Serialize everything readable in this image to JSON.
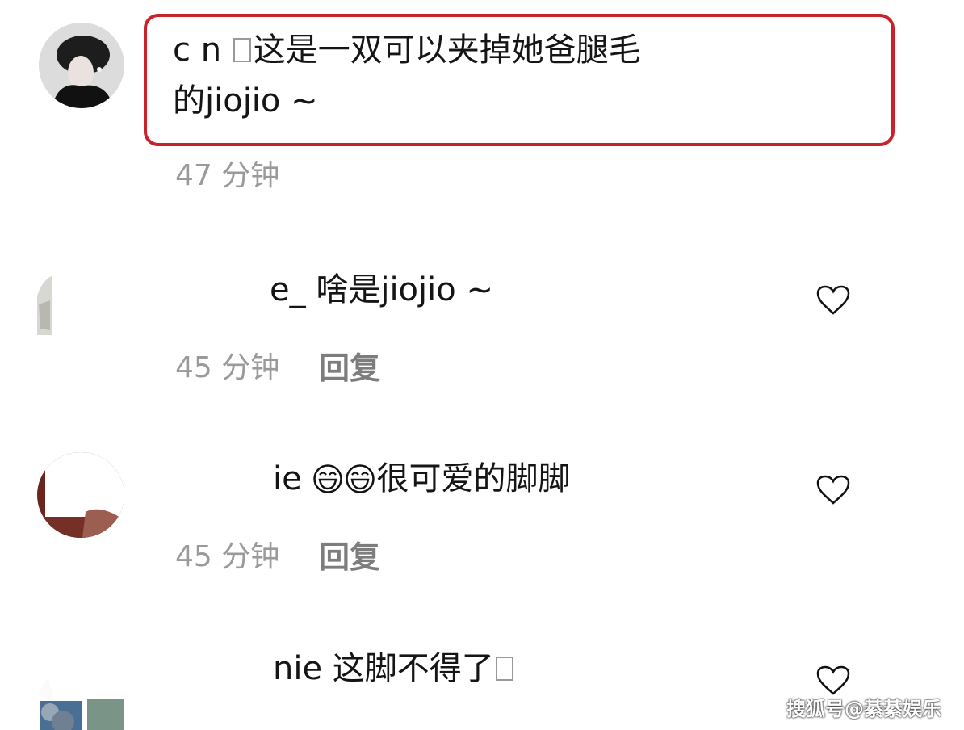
{
  "comments": [
    {
      "user": "c          n",
      "text_line1": "这是一双可以夹掉她爸腿毛",
      "text_line2": "的jiojio ~",
      "time": "47 分钟",
      "highlighted": true
    },
    {
      "user": "e_",
      "text": "啥是jiojio ~",
      "time": "45 分钟",
      "reply_label": "回复"
    },
    {
      "user": "ie",
      "text": "很可爱的脚脚",
      "time": "45 分钟",
      "reply_label": "回复"
    },
    {
      "user": "nie",
      "text": "这脚不得了"
    }
  ],
  "watermark": "搜狐号@綦綦娱乐",
  "colors": {
    "highlight_border": "#c9222a",
    "meta_text": "#9a9a9a",
    "reply_text": "#7d7d7d"
  },
  "icons": {
    "like": "heart-icon",
    "emoji": "laughing-face-icon",
    "missing_glyph": "missing-glyph-box"
  }
}
